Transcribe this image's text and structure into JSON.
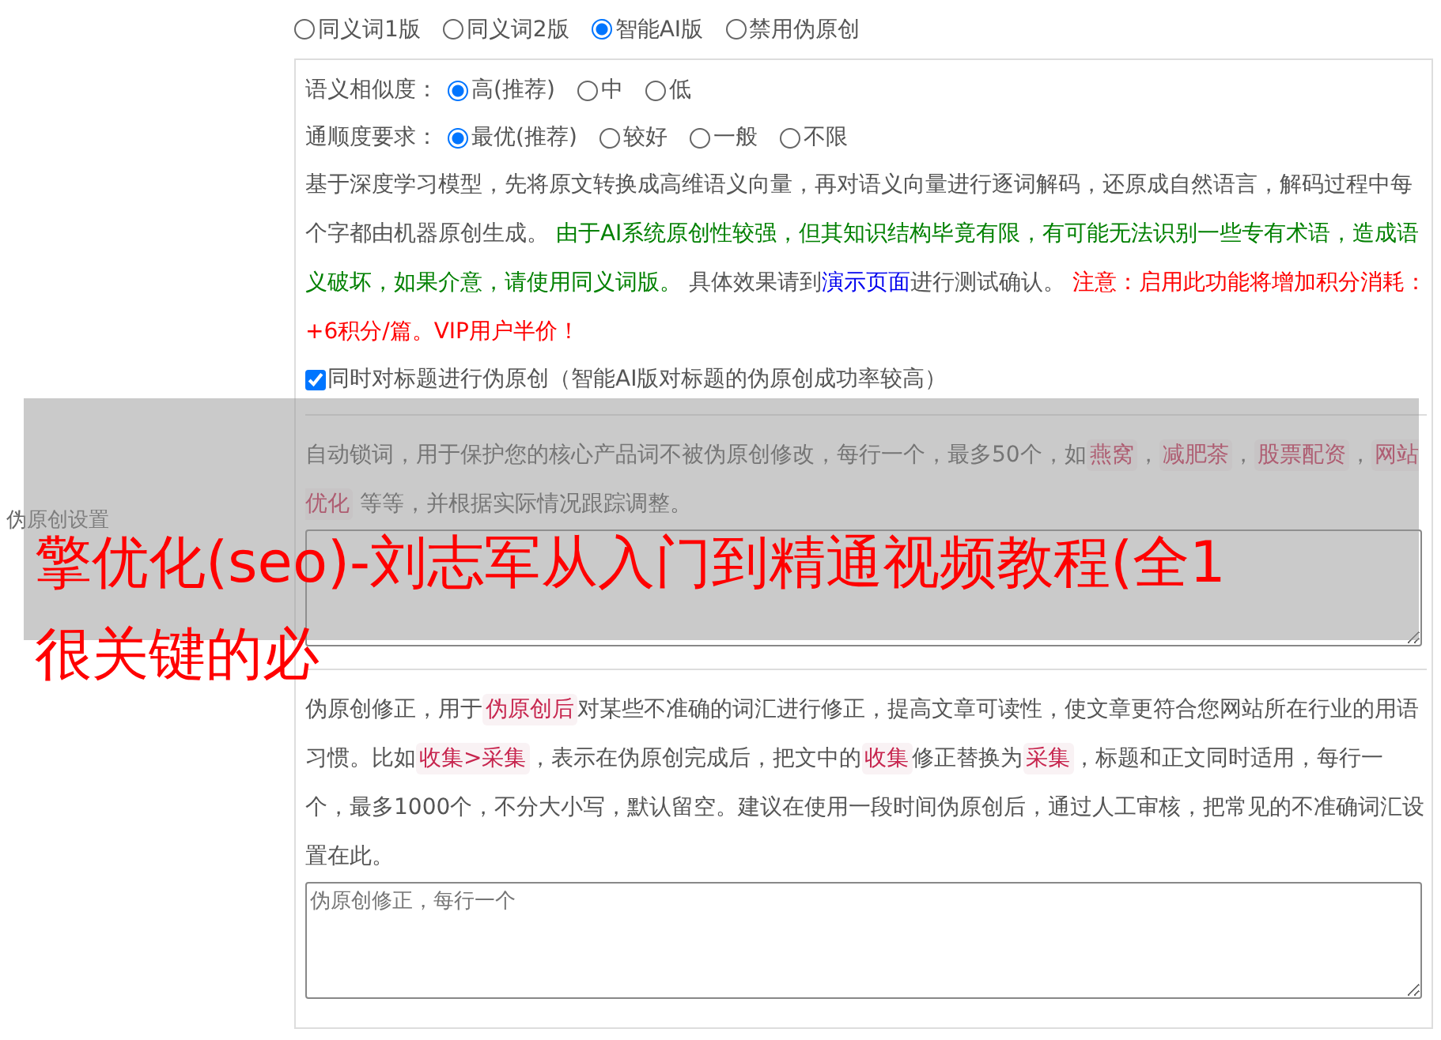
{
  "sidebar_label": "伪原创设置",
  "mode_options": [
    {
      "label": "同义词1版",
      "selected": false
    },
    {
      "label": "同义词2版",
      "selected": false
    },
    {
      "label": "智能AI版",
      "selected": true
    },
    {
      "label": "禁用伪原创",
      "selected": false
    }
  ],
  "ai_settings": {
    "similarity": {
      "label": "语义相似度：",
      "options": [
        {
          "label": "高(推荐)",
          "selected": true
        },
        {
          "label": "中",
          "selected": false
        },
        {
          "label": "低",
          "selected": false
        }
      ]
    },
    "fluency": {
      "label": "通顺度要求：",
      "options": [
        {
          "label": "最优(推荐)",
          "selected": true
        },
        {
          "label": "较好",
          "selected": false
        },
        {
          "label": "一般",
          "selected": false
        },
        {
          "label": "不限",
          "selected": false
        }
      ]
    },
    "description": [
      {
        "kind": "text",
        "text": "基于深度学习模型，先将原文转换成高维语义向量，再对语义向量进行逐词解码，还原成自然语言，解码过程中每个字都由机器原创生成。 "
      },
      {
        "kind": "note",
        "text": "由于AI系统原创性较强，但其知识结构毕竟有限，有可能无法识别一些专有术语，造成语义破坏，如果介意，请使用同义词版。"
      },
      {
        "kind": "text",
        "text": " 具体效果请到"
      },
      {
        "kind": "link",
        "text": "演示页面"
      },
      {
        "kind": "text",
        "text": "进行测试确认。 "
      },
      {
        "kind": "warning",
        "text": "注意：启用此功能将增加积分消耗：+6积分/篇。VIP用户半价！"
      }
    ],
    "title_checkbox": {
      "label": "同时对标题进行伪原创（智能AI版对标题的伪原创成功率较高）",
      "checked": true
    }
  },
  "lock_words": {
    "description": [
      {
        "kind": "text",
        "text": "自动锁词，用于保护您的核心产品词不被伪原创修改，每行一个，最多50个，如"
      },
      {
        "kind": "tag",
        "text": "燕窝"
      },
      {
        "kind": "text",
        "text": "，"
      },
      {
        "kind": "tag",
        "text": "减肥茶"
      },
      {
        "kind": "text",
        "text": "，"
      },
      {
        "kind": "tag",
        "text": "股票配资"
      },
      {
        "kind": "text",
        "text": "，"
      },
      {
        "kind": "tag",
        "text": "网站优化"
      },
      {
        "kind": "text",
        "text": " 等等，并根据实际情况跟踪调整。"
      }
    ]
  },
  "corrections": {
    "description": [
      {
        "kind": "text",
        "text": "伪原创修正，用于"
      },
      {
        "kind": "tag",
        "text": "伪原创后"
      },
      {
        "kind": "text",
        "text": "对某些不准确的词汇进行修正，提高文章可读性，使文章更符合您网站所在行业的用语习惯。比如"
      },
      {
        "kind": "tag",
        "text": "收集>采集"
      },
      {
        "kind": "text",
        "text": "，表示在伪原创完成后，把文中的"
      },
      {
        "kind": "tag",
        "text": "收集"
      },
      {
        "kind": "text",
        "text": "修正替换为"
      },
      {
        "kind": "tag",
        "text": "采集"
      },
      {
        "kind": "text",
        "text": "，标题和正文同时适用，每行一个，最多1000个，不分大小写，默认留空。建议在使用一段时间伪原创后，通过人工审核，把常见的不准确词汇设置在此。"
      }
    ],
    "placeholder": "伪原创修正，每行一个"
  },
  "overlay_banner": {
    "lines": [
      "擎优化(seo)-刘志军从入门到精通视频教程(全1",
      "很关键的必"
    ]
  }
}
